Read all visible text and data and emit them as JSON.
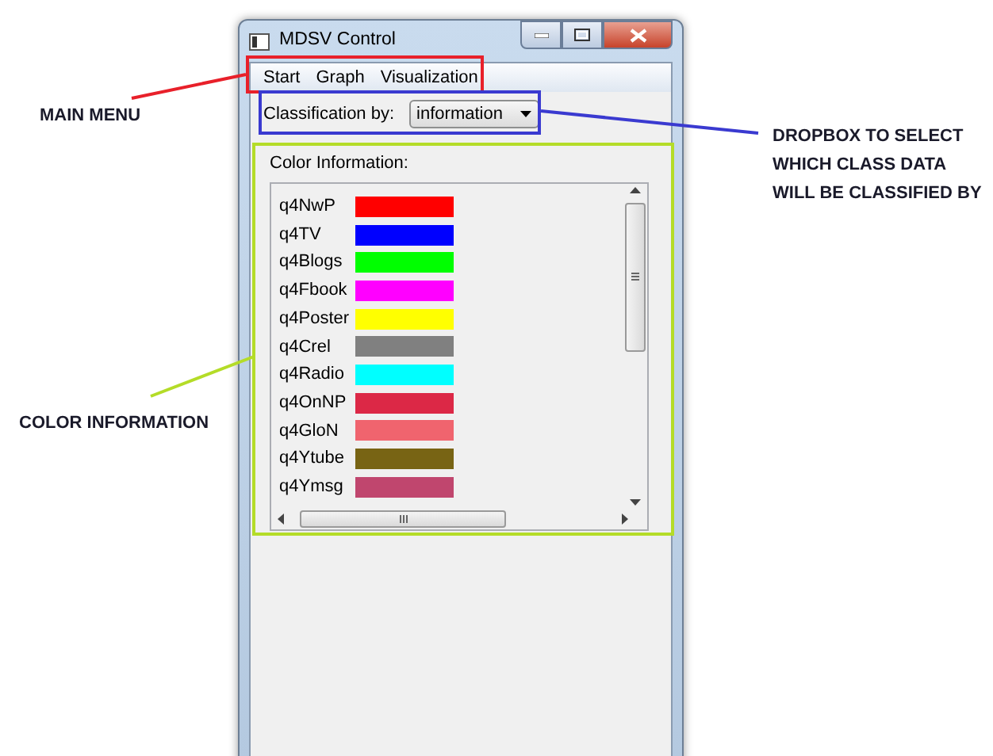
{
  "window": {
    "title": "MDSV Control"
  },
  "menu": [
    {
      "label": "Start"
    },
    {
      "label": "Graph"
    },
    {
      "label": "Visualization"
    }
  ],
  "classification": {
    "label": "Classification by:",
    "value": "information"
  },
  "color_info": {
    "title": "Color Information:",
    "items": [
      {
        "name": "q4NwP",
        "color": "#ff0000"
      },
      {
        "name": "q4TV",
        "color": "#0000ff"
      },
      {
        "name": "q4Blogs",
        "color": "#00ff00"
      },
      {
        "name": "q4Fbook",
        "color": "#ff00ff"
      },
      {
        "name": "q4Poster",
        "color": "#ffff00"
      },
      {
        "name": "q4Crel",
        "color": "#808080"
      },
      {
        "name": "q4Radio",
        "color": "#00ffff"
      },
      {
        "name": "q4OnNP",
        "color": "#dc2846"
      },
      {
        "name": "q4GloN",
        "color": "#f0646e"
      },
      {
        "name": "q4Ytube",
        "color": "#786414"
      },
      {
        "name": "q4Ymsg",
        "color": "#c0466e"
      }
    ]
  },
  "annotations": [
    {
      "text": "MAIN MENU",
      "color": "#e8202a"
    },
    {
      "text": "DROPBOX TO SELECT WHICH CLASS DATA WILL BE CLASSIFIED BY",
      "color": "#3a3ad0"
    },
    {
      "text": "COLOR INFORMATION",
      "color": "#b4dc28"
    }
  ]
}
